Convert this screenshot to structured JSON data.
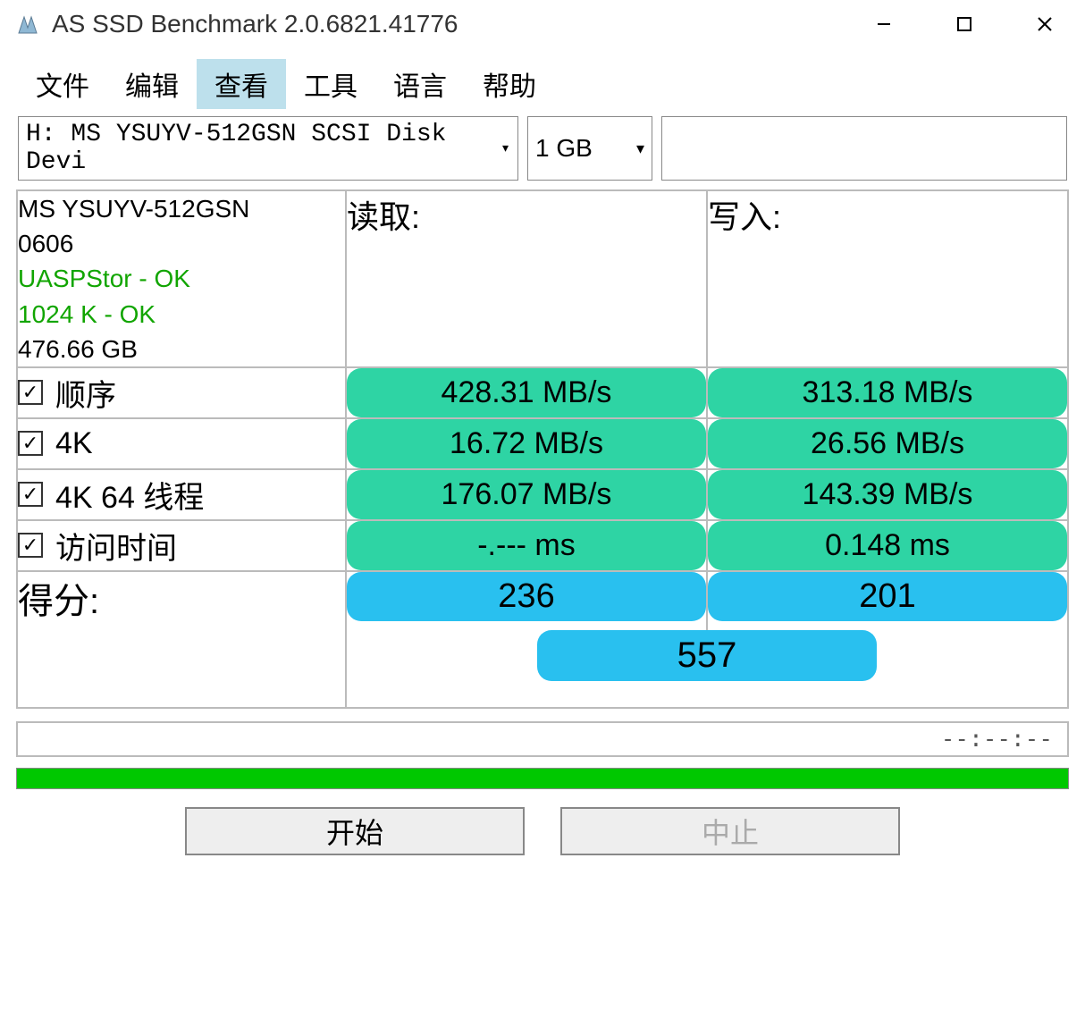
{
  "window": {
    "title": "AS SSD Benchmark 2.0.6821.41776"
  },
  "menu": {
    "file": "文件",
    "edit": "编辑",
    "view": "查看",
    "tools": "工具",
    "language": "语言",
    "help": "帮助"
  },
  "selectors": {
    "drive": "H: MS YSUYV-512GSN SCSI Disk Devi",
    "size": "1 GB"
  },
  "info": {
    "model": "MS YSUYV-512GSN",
    "firmware": "0606",
    "driver_status": "UASPStor - OK",
    "alignment_status": "1024 K - OK",
    "capacity": "476.66 GB"
  },
  "headers": {
    "read": "读取:",
    "write": "写入:"
  },
  "rows": {
    "seq": {
      "label": "顺序",
      "read": "428.31 MB/s",
      "write": "313.18 MB/s"
    },
    "fourk": {
      "label": "4K",
      "read": "16.72 MB/s",
      "write": "26.56 MB/s"
    },
    "fourk64": {
      "label": "4K 64 线程",
      "read": "176.07 MB/s",
      "write": "143.39 MB/s"
    },
    "access": {
      "label": "访问时间",
      "read": "-.--- ms",
      "write": "0.148 ms"
    }
  },
  "score": {
    "label": "得分:",
    "read": "236",
    "write": "201",
    "total": "557"
  },
  "timer": "--:--:--",
  "buttons": {
    "start": "开始",
    "stop": "中止"
  }
}
